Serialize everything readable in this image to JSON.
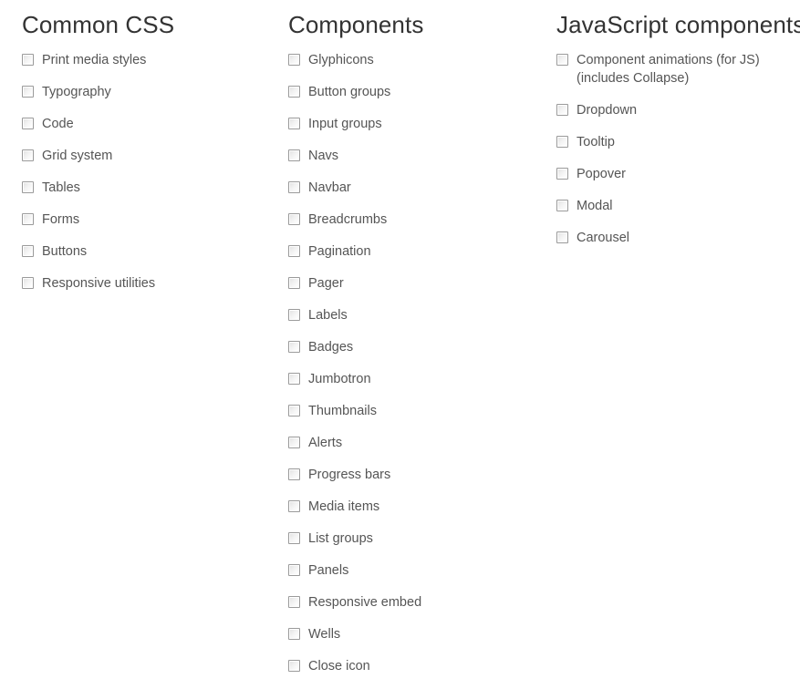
{
  "page": {
    "background_color": "#ffffff",
    "heading_color": "#333333",
    "item_text_color": "#555555",
    "checkbox_border_color": "#9a9a9a"
  },
  "columns": [
    {
      "heading": "Common CSS",
      "items": [
        {
          "label": "Print media styles",
          "checked": false
        },
        {
          "label": "Typography",
          "checked": false
        },
        {
          "label": "Code",
          "checked": false
        },
        {
          "label": "Grid system",
          "checked": false
        },
        {
          "label": "Tables",
          "checked": false
        },
        {
          "label": "Forms",
          "checked": false
        },
        {
          "label": "Buttons",
          "checked": false
        },
        {
          "label": "Responsive utilities",
          "checked": false
        }
      ]
    },
    {
      "heading": "Components",
      "items": [
        {
          "label": "Glyphicons",
          "checked": false
        },
        {
          "label": "Button groups",
          "checked": false
        },
        {
          "label": "Input groups",
          "checked": false
        },
        {
          "label": "Navs",
          "checked": false
        },
        {
          "label": "Navbar",
          "checked": false
        },
        {
          "label": "Breadcrumbs",
          "checked": false
        },
        {
          "label": "Pagination",
          "checked": false
        },
        {
          "label": "Pager",
          "checked": false
        },
        {
          "label": "Labels",
          "checked": false
        },
        {
          "label": "Badges",
          "checked": false
        },
        {
          "label": "Jumbotron",
          "checked": false
        },
        {
          "label": "Thumbnails",
          "checked": false
        },
        {
          "label": "Alerts",
          "checked": false
        },
        {
          "label": "Progress bars",
          "checked": false
        },
        {
          "label": "Media items",
          "checked": false
        },
        {
          "label": "List groups",
          "checked": false
        },
        {
          "label": "Panels",
          "checked": false
        },
        {
          "label": "Responsive embed",
          "checked": false
        },
        {
          "label": "Wells",
          "checked": false
        },
        {
          "label": "Close icon",
          "checked": false
        }
      ]
    },
    {
      "heading": "JavaScript components",
      "items": [
        {
          "label": "Component animations (for JS)",
          "label_line2": "(includes Collapse)",
          "checked": false
        },
        {
          "label": "Dropdown",
          "checked": false
        },
        {
          "label": "Tooltip",
          "checked": false
        },
        {
          "label": "Popover",
          "checked": false
        },
        {
          "label": "Modal",
          "checked": false
        },
        {
          "label": "Carousel",
          "checked": false
        }
      ]
    }
  ],
  "icons": {
    "checkbox": "checkbox-icon"
  }
}
